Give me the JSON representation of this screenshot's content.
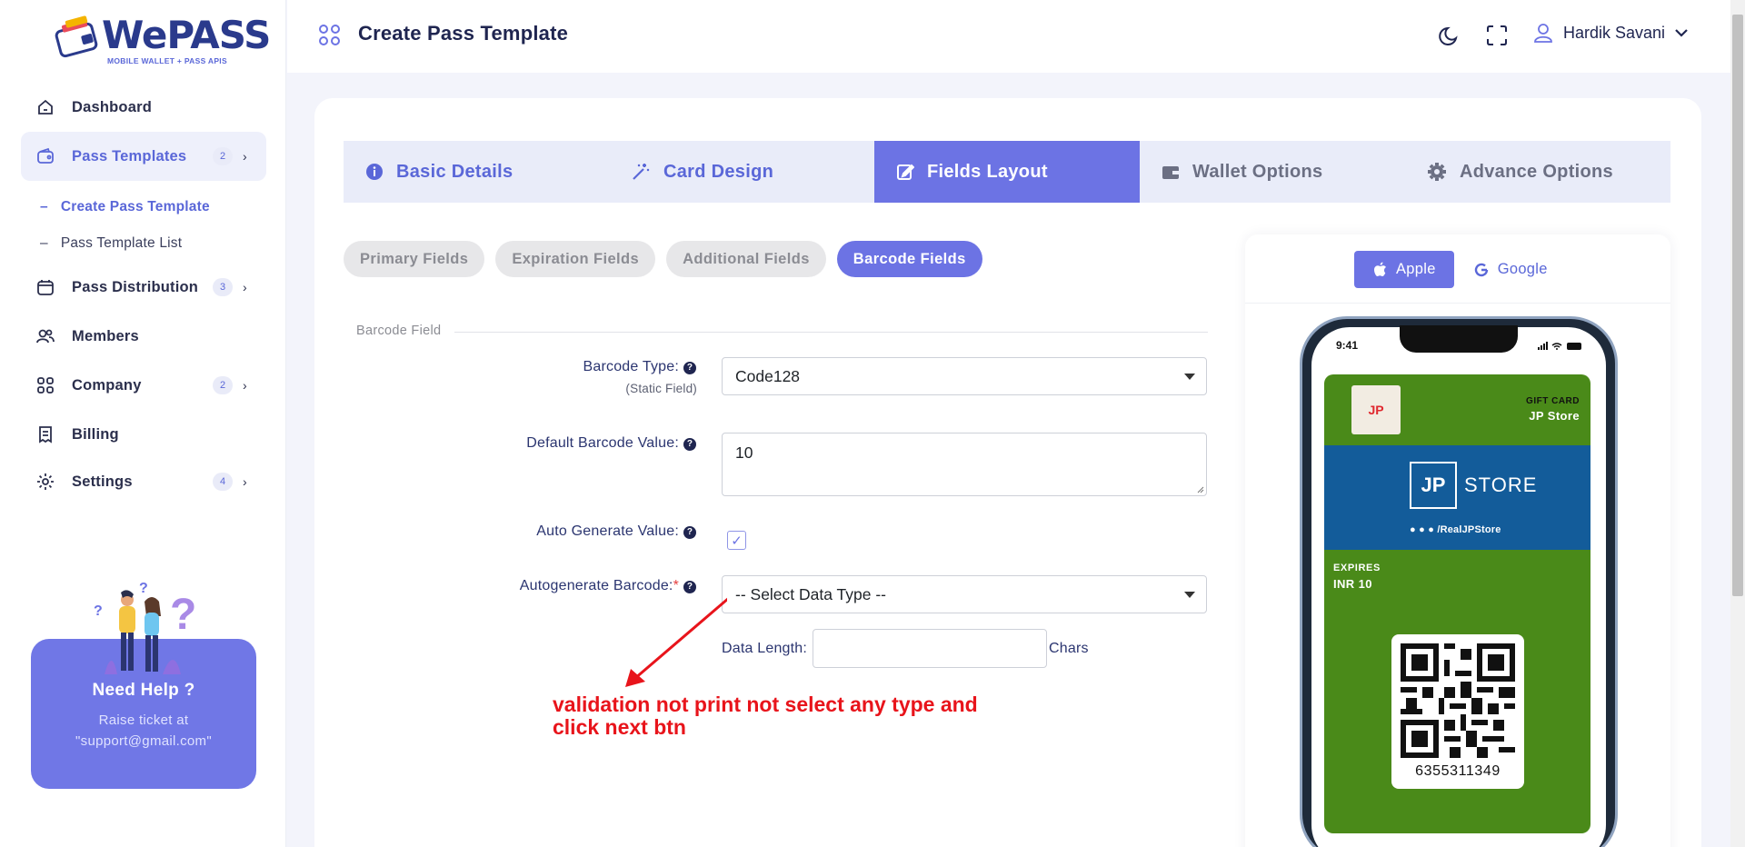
{
  "brand": {
    "name": "WePASS",
    "tagline": "MOBILE WALLET + PASS APIS"
  },
  "sidebar": {
    "items": [
      {
        "label": "Dashboard",
        "icon": "home-icon"
      },
      {
        "label": "Pass Templates",
        "icon": "wallet-icon",
        "badge": "2",
        "active": true
      },
      {
        "label": "Pass Distribution",
        "icon": "calendar-icon",
        "badge": "3"
      },
      {
        "label": "Members",
        "icon": "users-icon"
      },
      {
        "label": "Company",
        "icon": "grid-icon",
        "badge": "2"
      },
      {
        "label": "Billing",
        "icon": "receipt-icon"
      },
      {
        "label": "Settings",
        "icon": "gear-icon",
        "badge": "4"
      }
    ],
    "subitems": [
      {
        "label": "Create Pass Template",
        "active": true
      },
      {
        "label": "Pass Template List"
      }
    ],
    "help": {
      "title": "Need Help ?",
      "line1": "Raise ticket at",
      "line2": "\"support@gmail.com\""
    }
  },
  "header": {
    "title": "Create Pass Template",
    "user": "Hardik Savani"
  },
  "tabs": [
    {
      "label": "Basic Details",
      "icon": "info-icon"
    },
    {
      "label": "Card Design",
      "icon": "magic-wand-icon"
    },
    {
      "label": "Fields Layout",
      "icon": "edit-icon",
      "active": true
    },
    {
      "label": "Wallet Options",
      "icon": "wallet-icon"
    },
    {
      "label": "Advance Options",
      "icon": "gear-icon"
    }
  ],
  "subtabs": [
    "Primary Fields",
    "Expiration Fields",
    "Additional Fields",
    "Barcode Fields"
  ],
  "form": {
    "legend": "Barcode Field",
    "barcode_type_label": "Barcode Type:",
    "barcode_type_sub": "(Static Field)",
    "barcode_type_value": "Code128",
    "default_value_label": "Default Barcode Value:",
    "default_value": "10",
    "auto_generate_label": "Auto Generate Value:",
    "auto_generate_checked": true,
    "autogen_barcode_label": "Autogenerate Barcode:",
    "autogen_barcode_value": "-- Select Data Type --",
    "data_length_label": "Data Length:",
    "data_length_value": "",
    "chars_label": "Chars"
  },
  "annotation": {
    "text": "validation not print not select any type and click next btn",
    "color": "#e8141b"
  },
  "preview": {
    "os_tabs": [
      "Apple",
      "Google"
    ],
    "time": "9:41",
    "pass": {
      "header_label": "GIFT CARD",
      "header_value": "JP Store",
      "logo_text": "JP",
      "strip_jp": "JP",
      "strip_store": "STORE",
      "social": "/RealJPStore",
      "exp_label": "EXPIRES",
      "exp_value": "INR 10",
      "barcode_number": "6355311349",
      "background_color": "#4a8a19",
      "strip_color": "#135c9a"
    }
  },
  "colors": {
    "accent": "#6c73e4",
    "text": "#2b2f4c"
  }
}
